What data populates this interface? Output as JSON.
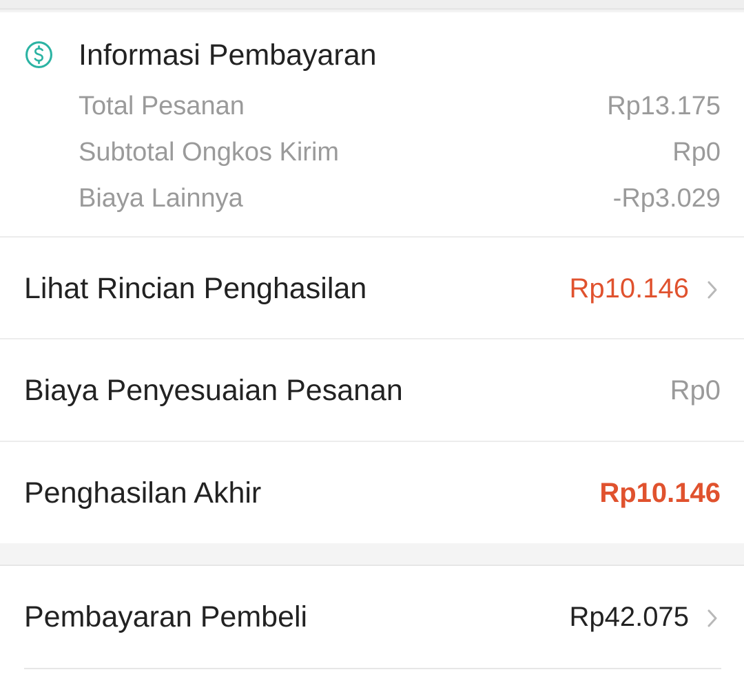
{
  "payment_info": {
    "title": "Informasi Pembayaran",
    "icon": "dollar-circle-icon",
    "accent_color": "#2bb3a3",
    "rows": [
      {
        "label": "Total Pesanan",
        "value": "Rp13.175"
      },
      {
        "label": "Subtotal Ongkos Kirim",
        "value": "Rp0"
      },
      {
        "label": "Biaya Lainnya",
        "value": "-Rp3.029"
      }
    ]
  },
  "income_details": {
    "label": "Lihat Rincian Penghasilan",
    "value": "Rp10.146",
    "value_color": "#e0522e"
  },
  "order_adjustment": {
    "label": "Biaya Penyesuaian Pesanan",
    "value": "Rp0"
  },
  "final_income": {
    "label": "Penghasilan Akhir",
    "value": "Rp10.146",
    "value_color": "#e0522e"
  },
  "buyer_payment": {
    "label": "Pembayaran Pembeli",
    "value": "Rp42.075"
  }
}
